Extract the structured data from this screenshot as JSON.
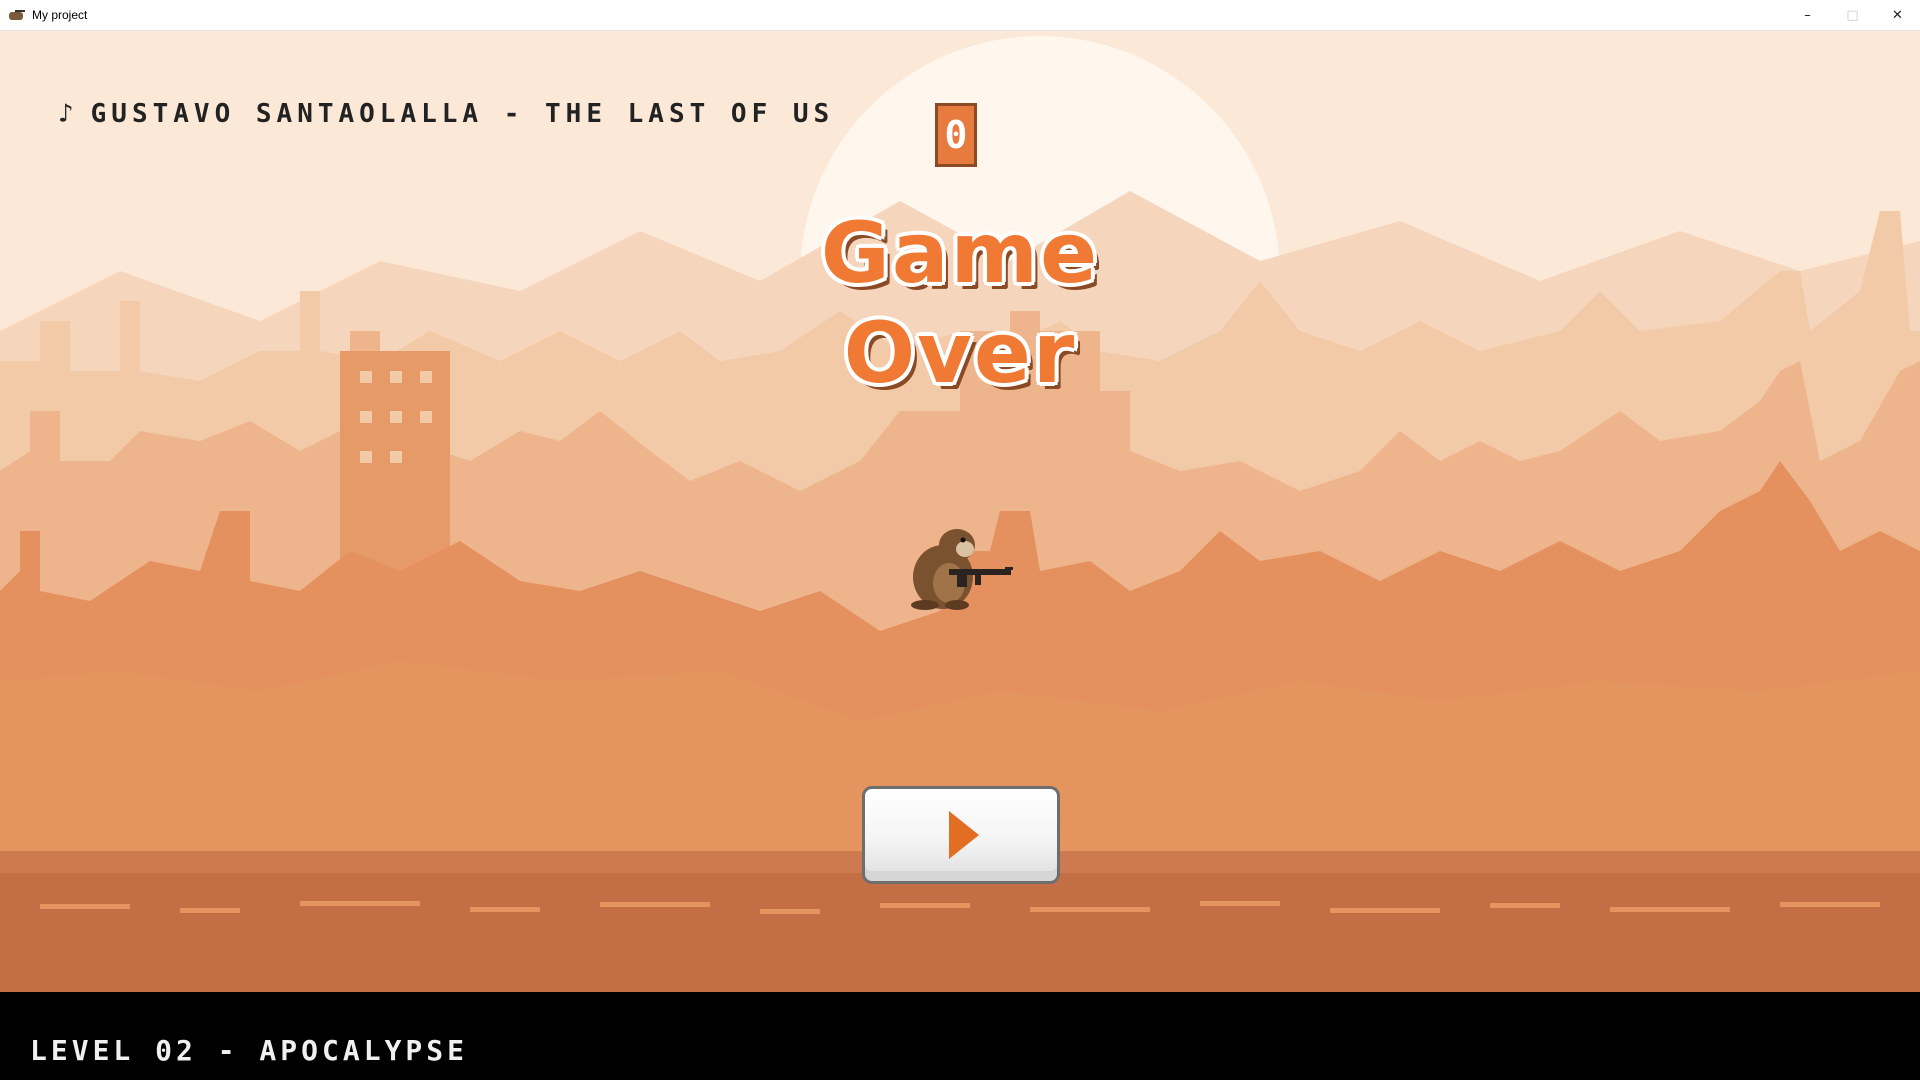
{
  "window": {
    "title": "My project",
    "minimize_glyph": "–",
    "maximize_glyph": "□",
    "close_glyph": "✕"
  },
  "hud": {
    "song_icon": "♪",
    "song_title": "GUSTAVO SANTAOLALLA - THE LAST OF US",
    "score": "0",
    "game_over": "Game Over",
    "level": "LEVEL 02 - APOCALYPSE"
  },
  "colors": {
    "sky": "#fbe8d6",
    "sun": "#fff6ee",
    "accent_orange": "#f07a34",
    "ground": "#c46e46",
    "footer": "#000000"
  },
  "icons": {
    "app": "groundhog-with-gun-icon",
    "play": "play-icon",
    "note": "music-note-icon"
  }
}
